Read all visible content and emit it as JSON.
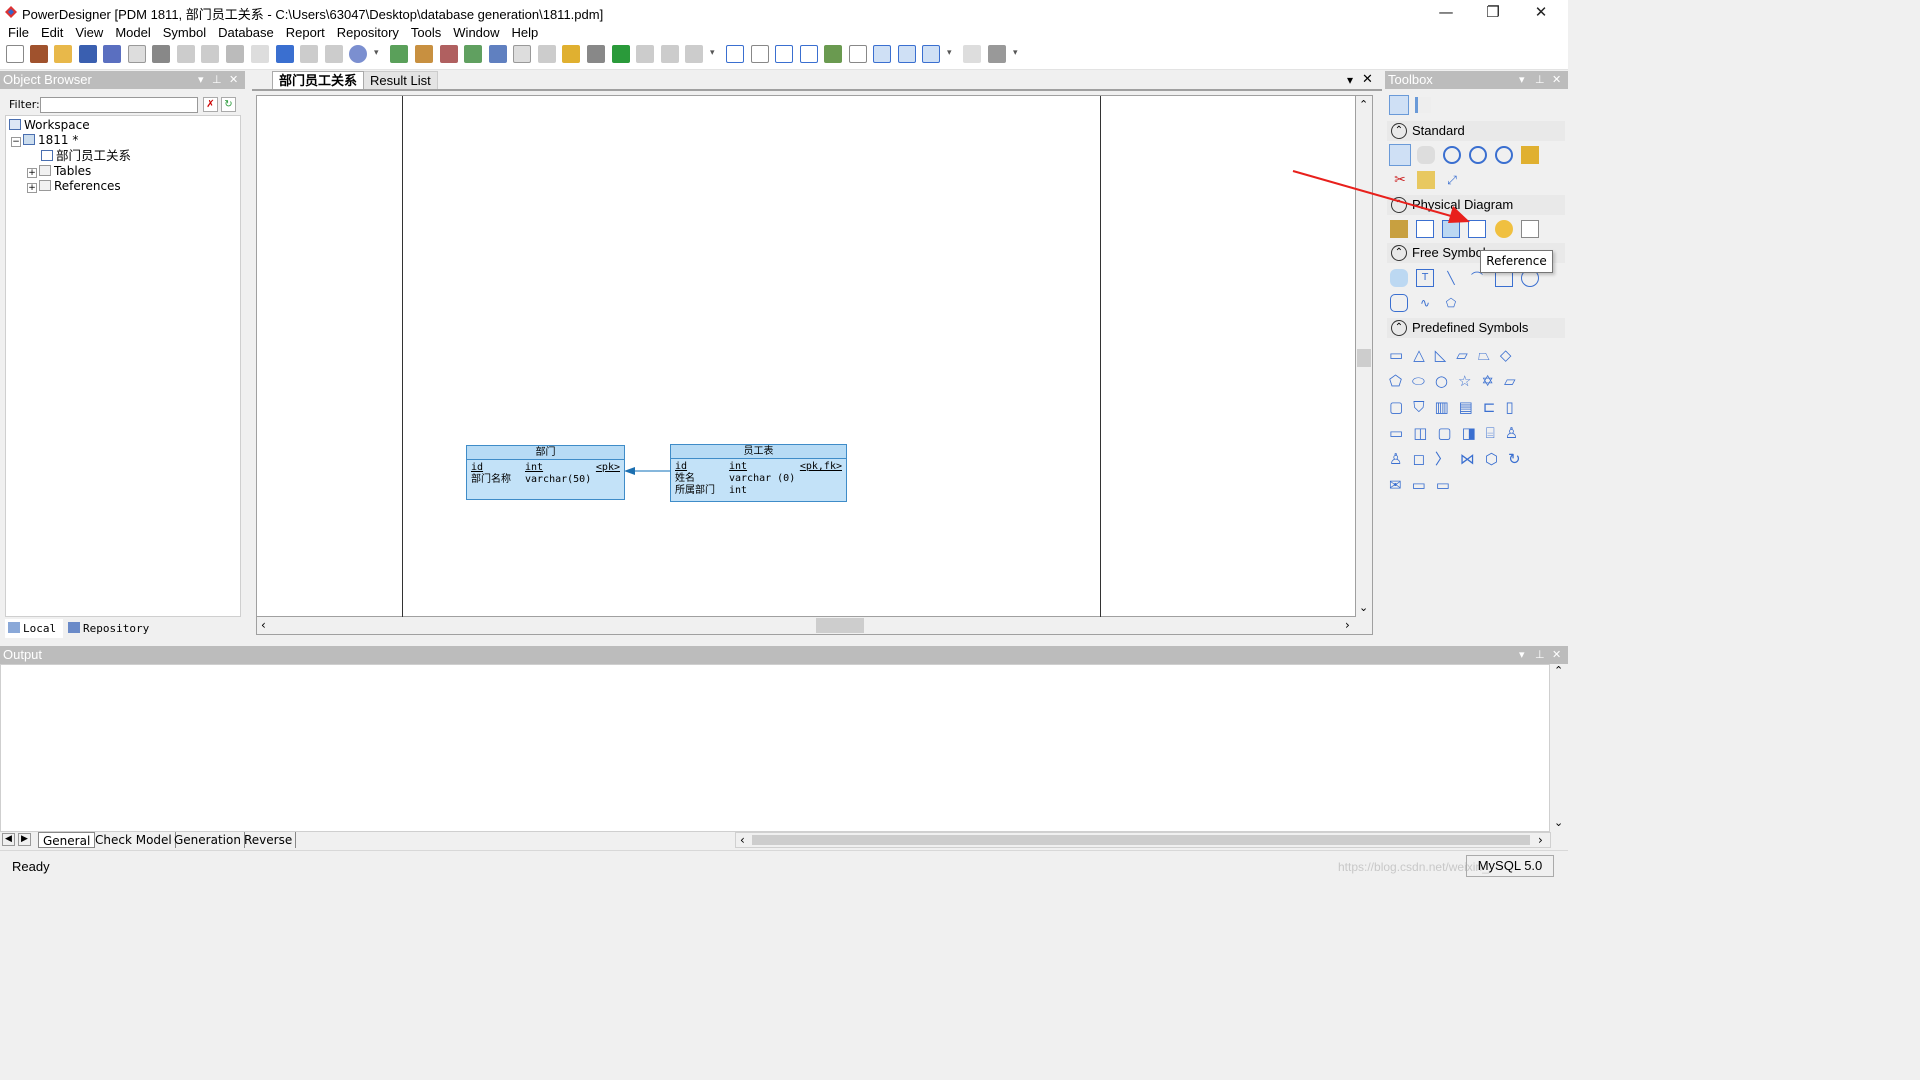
{
  "window": {
    "title": "PowerDesigner [PDM 1811, 部门员工关系 - C:\\Users\\63047\\Desktop\\database generation\\1811.pdm]",
    "minimize": "—",
    "restore": "❐",
    "close": "✕"
  },
  "menu": [
    "File",
    "Edit",
    "View",
    "Model",
    "Symbol",
    "Database",
    "Report",
    "Repository",
    "Tools",
    "Window",
    "Help"
  ],
  "object_browser": {
    "title": "Object Browser",
    "filter_label": "Filter:",
    "filter_value": "",
    "tree": [
      "Workspace",
      "1811 *",
      "部门员工关系",
      "Tables",
      "References"
    ],
    "bottom_tabs": [
      "Local",
      "Repository"
    ]
  },
  "document_tabs": [
    "部门员工关系",
    "Result List"
  ],
  "diagram": {
    "dept": {
      "name": "部门",
      "rows": [
        {
          "col": "id",
          "type": "int",
          "key": "<pk>"
        },
        {
          "col": "部门名称",
          "type": "varchar(50)",
          "key": ""
        }
      ]
    },
    "emp": {
      "name": "员工表",
      "rows": [
        {
          "col": "id",
          "type": "int",
          "key": "<pk,fk>"
        },
        {
          "col": "姓名",
          "type": "varchar (0)",
          "key": ""
        },
        {
          "col": "所属部门",
          "type": "int",
          "key": ""
        }
      ]
    }
  },
  "toolbox": {
    "title": "Toolbox",
    "sections": [
      "Standard",
      "Physical Diagram",
      "Free Symbols",
      "Predefined Symbols"
    ],
    "tooltip": "Reference"
  },
  "output": {
    "title": "Output",
    "tabs": [
      "General",
      "Check Model",
      "Generation",
      "Reverse"
    ]
  },
  "status": {
    "text": "Ready",
    "dbms": "MySQL 5.0",
    "watermark": "https://blog.csdn.net/weixin_"
  },
  "colors": {
    "accent": "#3f8cc8",
    "entity_fill": "#c3e2f8",
    "arrow_red": "#e8201c",
    "panel_title": "#bcbcbc"
  }
}
